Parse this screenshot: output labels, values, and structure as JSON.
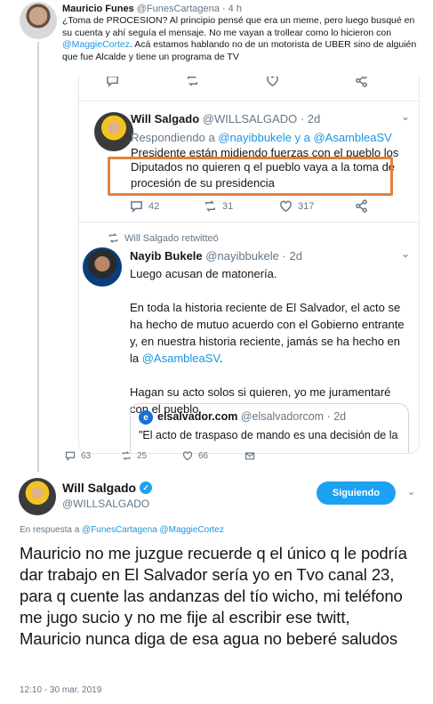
{
  "top_tweet": {
    "name": "Mauricio Funes",
    "handle": "@FunesCartagena",
    "sep": "·",
    "time": "4 h",
    "body_line1": "¿Toma de PROCESION? Al principio pensé que era un meme, pero luego busqué en su cuenta y ahí seguía el mensaje. No me vayan a trollear como lo hicieron con ",
    "body_mention": "@MaggieCortez",
    "body_line2": ". Acá estamos hablando no de un motorista de UBER sino de alguién que fue Alcalde y tiene un programa de TV",
    "actions": {
      "replies": "63",
      "retweets": "25",
      "likes": "66"
    },
    "embed": {
      "ws_tweet": {
        "name": "Will Salgado",
        "handle": "@WILLSALGADO",
        "time": "2d",
        "replying_prefix": "Respondiendo a ",
        "replying_users": "@nayibbukele y a @AsambleaSV",
        "text_line_a": "Presidente están midiendo fuerzas con el pueblo los",
        "text_line_b": "Diputados no quieren q el pueblo vaya a la toma de procesión de su presidencia",
        "actions": {
          "replies": "42",
          "retweets": "31",
          "likes": "317"
        }
      },
      "retweeted_label": "Will Salgado retwitteó",
      "nb_tweet": {
        "name": "Nayib Bukele",
        "handle": "@nayibbukele",
        "time": "2d",
        "para1": "Luego acusan de matonería.",
        "para2_text": "En toda la historia reciente de El Salvador, el acto se ha hecho de mutuo acuerdo con el Gobierno entrante y, en nuestra historia reciente, jamás se ha hecho en la ",
        "para2_mention": "@AsambleaSV",
        "para2_end": ".",
        "para3": "Hagan su acto solos si quieren, yo me juramentaré con el pueblo.",
        "quote": {
          "logo": "e",
          "name": "elsalvador.com",
          "handle": "@elsalvadorcom",
          "time": "2d",
          "text": "\"El acto de traspaso de mando es una decisión de la"
        }
      }
    }
  },
  "main_tweet": {
    "name": "Will Salgado",
    "verified_mark": "✓",
    "handle": "@WILLSALGADO",
    "follow_label": "Siguiendo",
    "reply_prefix": "En respuesta a ",
    "reply_users": "@FunesCartagena @MaggieCortez",
    "body": "Mauricio no me juzgue recuerde q el único q le podría dar trabajo en El Salvador sería yo en Tvo canal 23, para q cuente las andanzas del tío wicho, mi teléfono me jugo sucio y no me fije al escribir ese twitt, Mauricio nunca diga de esa agua no beberé saludos",
    "timestamp": "12:10 - 30 mar. 2019"
  },
  "icons": [
    "reply-icon",
    "retweet-icon",
    "like-icon",
    "share-icon",
    "chevron-down-icon",
    "verified-icon"
  ],
  "colors": {
    "link": "#1b95e0",
    "follow_button": "#1da1f2",
    "highlight_box": "#e5813b",
    "muted": "#657786"
  }
}
